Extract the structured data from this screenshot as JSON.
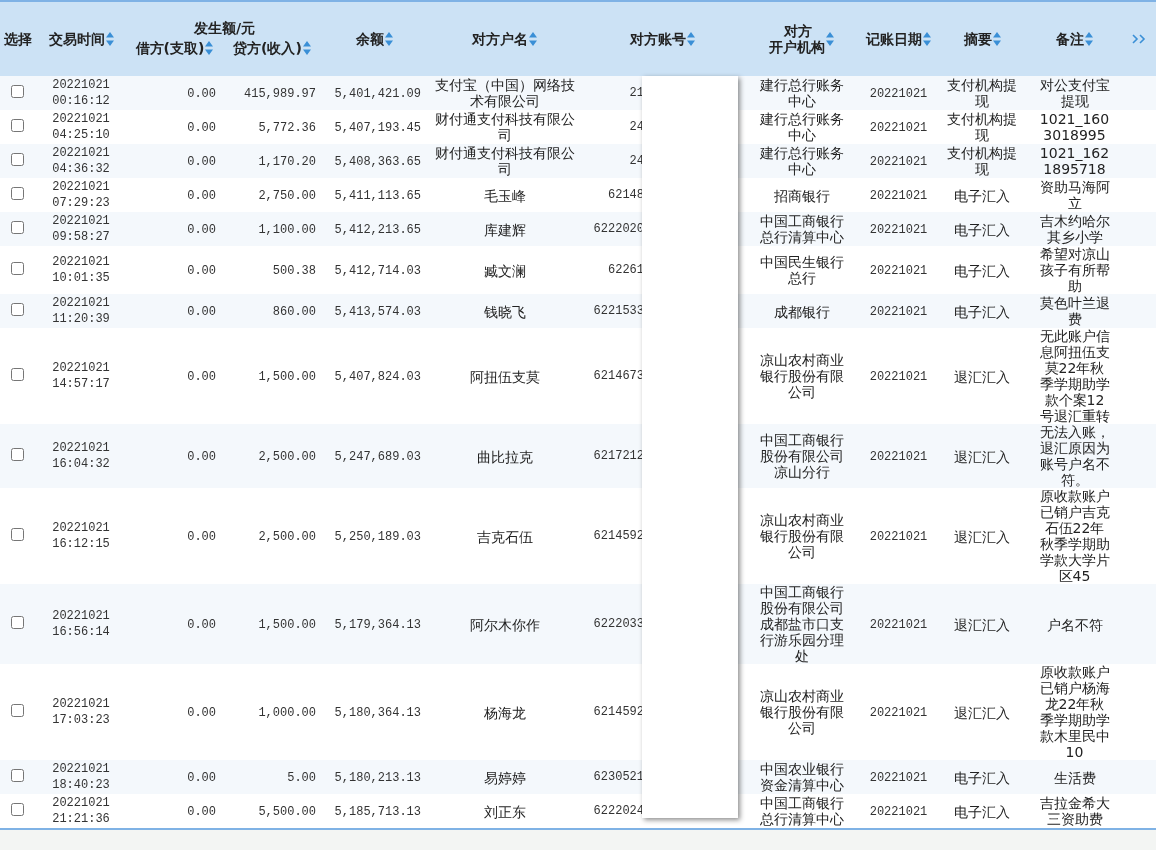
{
  "columns": [
    {
      "kind": "column",
      "label": "选择",
      "sortable": false
    },
    {
      "kind": "column",
      "label": "交易时间",
      "sortable": true
    },
    {
      "kind": "group",
      "label": "发生额/元",
      "columns": [
        {
          "label": "借方(支取)",
          "sortable": true
        },
        {
          "label": "贷方(收入)",
          "sortable": true
        }
      ]
    },
    {
      "kind": "column",
      "label": "余额",
      "sortable": true
    },
    {
      "kind": "column",
      "label": "对方户名",
      "sortable": true
    },
    {
      "kind": "column",
      "label": "对方账号",
      "sortable": true
    },
    {
      "kind": "column",
      "label": "对方开户机构",
      "sortable": true
    },
    {
      "kind": "column",
      "label": "记账日期",
      "sortable": true
    },
    {
      "kind": "column",
      "label": "摘要",
      "sortable": true
    },
    {
      "kind": "column",
      "label": "备注",
      "sortable": true
    }
  ],
  "rows": [
    {
      "checked": false,
      "time": "20221021\n00:16:12",
      "debit": "0.00",
      "credit": "415,989.97",
      "balance": "5,401,421.09",
      "name": "支付宝（中国）网络技术有限公司",
      "account": "21",
      "bank": "建行总行账务中心",
      "date": "20221021",
      "summary": "支付机构提现",
      "note": "对公支付宝提现"
    },
    {
      "checked": false,
      "time": "20221021\n04:25:10",
      "debit": "0.00",
      "credit": "5,772.36",
      "balance": "5,407,193.45",
      "name": "财付通支付科技有限公司",
      "account": "24",
      "bank": "建行总行账务中心",
      "date": "20221021",
      "summary": "支付机构提现",
      "note": "1021_1603018995"
    },
    {
      "checked": false,
      "time": "20221021\n04:36:32",
      "debit": "0.00",
      "credit": "1,170.20",
      "balance": "5,408,363.65",
      "name": "财付通支付科技有限公司",
      "account": "24",
      "bank": "建行总行账务中心",
      "date": "20221021",
      "summary": "支付机构提现",
      "note": "1021_1621895718"
    },
    {
      "checked": false,
      "time": "20221021\n07:29:23",
      "debit": "0.00",
      "credit": "2,750.00",
      "balance": "5,411,113.65",
      "name": "毛玉峰",
      "account": "62148",
      "bank": "招商银行",
      "date": "20221021",
      "summary": "电子汇入",
      "note": "资助马海阿立"
    },
    {
      "checked": false,
      "time": "20221021\n09:58:27",
      "debit": "0.00",
      "credit": "1,100.00",
      "balance": "5,412,213.65",
      "name": "库建辉",
      "account": "6222020",
      "bank": "中国工商银行总行清算中心",
      "date": "20221021",
      "summary": "电子汇入",
      "note": "吉木约哈尔其乡小学"
    },
    {
      "checked": false,
      "time": "20221021\n10:01:35",
      "debit": "0.00",
      "credit": "500.38",
      "balance": "5,412,714.03",
      "name": "臧文澜",
      "account": "62261",
      "bank": "中国民生银行总行",
      "date": "20221021",
      "summary": "电子汇入",
      "note": "希望对凉山孩子有所帮助"
    },
    {
      "checked": false,
      "time": "20221021\n11:20:39",
      "debit": "0.00",
      "credit": "860.00",
      "balance": "5,413,574.03",
      "name": "钱晓飞",
      "account": "6221533",
      "bank": "成都银行",
      "date": "20221021",
      "summary": "电子汇入",
      "note": "莫色叶兰退费"
    },
    {
      "checked": false,
      "time": "20221021\n14:57:17",
      "debit": "0.00",
      "credit": "1,500.00",
      "balance": "5,407,824.03",
      "name": "阿扭伍支莫",
      "account": "6214673",
      "bank": "凉山农村商业银行股份有限公司",
      "date": "20221021",
      "summary": "退汇汇入",
      "note": "无此账户信息阿扭伍支莫22年秋季学期助学款个案12号退汇重转"
    },
    {
      "checked": false,
      "time": "20221021\n16:04:32",
      "debit": "0.00",
      "credit": "2,500.00",
      "balance": "5,247,689.03",
      "name": "曲比拉克",
      "account": "6217212",
      "bank": "中国工商银行股份有限公司凉山分行",
      "date": "20221021",
      "summary": "退汇汇入",
      "note": "无法入账，退汇原因为账号户名不符。"
    },
    {
      "checked": false,
      "time": "20221021\n16:12:15",
      "debit": "0.00",
      "credit": "2,500.00",
      "balance": "5,250,189.03",
      "name": "吉克石伍",
      "account": "6214592",
      "bank": "凉山农村商业银行股份有限公司",
      "date": "20221021",
      "summary": "退汇汇入",
      "note": "原收款账户已销户吉克石伍22年秋季学期助学款大学片区45"
    },
    {
      "checked": false,
      "time": "20221021\n16:56:14",
      "debit": "0.00",
      "credit": "1,500.00",
      "balance": "5,179,364.13",
      "name": "阿尔木你作",
      "account": "6222033",
      "bank": "中国工商银行股份有限公司成都盐市口支行游乐园分理处",
      "date": "20221021",
      "summary": "退汇汇入",
      "note": "户名不符"
    },
    {
      "checked": false,
      "time": "20221021\n17:03:23",
      "debit": "0.00",
      "credit": "1,000.00",
      "balance": "5,180,364.13",
      "name": "杨海龙",
      "account": "6214592",
      "bank": "凉山农村商业银行股份有限公司",
      "date": "20221021",
      "summary": "退汇汇入",
      "note": "原收款账户已销户杨海龙22年秋季学期助学款木里民中10"
    },
    {
      "checked": false,
      "time": "20221021\n18:40:23",
      "debit": "0.00",
      "credit": "5.00",
      "balance": "5,180,213.13",
      "name": "易婷婷",
      "account": "6230521",
      "bank": "中国农业银行资金清算中心",
      "date": "20221021",
      "summary": "电子汇入",
      "note": "生活费"
    },
    {
      "checked": false,
      "time": "20221021\n21:21:36",
      "debit": "0.00",
      "credit": "5,500.00",
      "balance": "5,185,713.13",
      "name": "刘正东",
      "account": "6222024",
      "bank": "中国工商银行总行清算中心",
      "date": "20221021",
      "summary": "电子汇入",
      "note": "吉拉金希大三资助费"
    }
  ]
}
